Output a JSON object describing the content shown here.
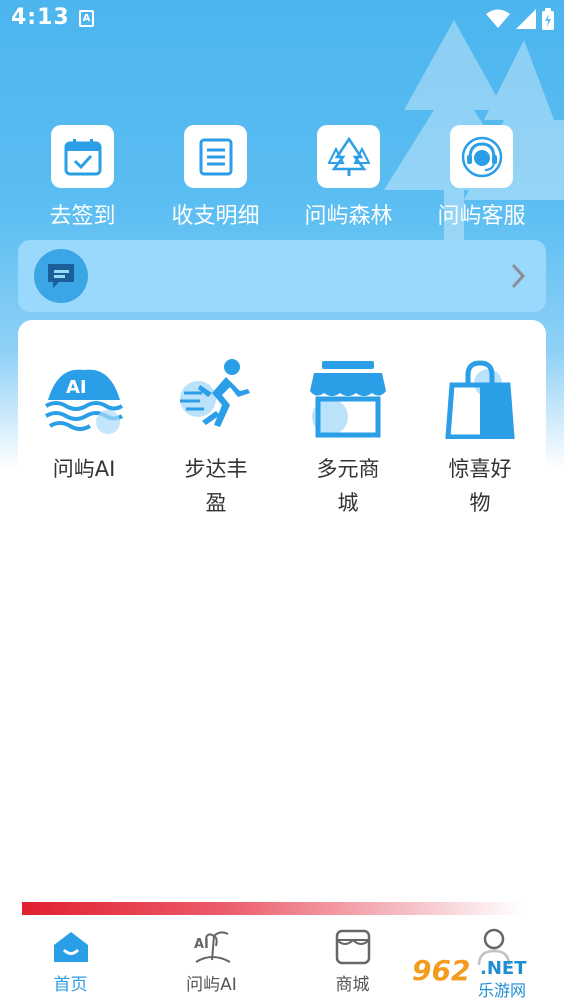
{
  "status_bar": {
    "time": "4:13",
    "app_indicator": "A"
  },
  "quick_actions": [
    {
      "label": "去签到",
      "icon": "calendar-check-icon"
    },
    {
      "label": "收支明细",
      "icon": "document-list-icon"
    },
    {
      "label": "问屿森林",
      "icon": "forest-icon"
    },
    {
      "label": "问屿客服",
      "icon": "customer-service-icon"
    }
  ],
  "notice": {
    "icon": "message-icon",
    "text": ""
  },
  "services": [
    {
      "label": "问屿AI",
      "icon": "ai-island-icon"
    },
    {
      "label": "步达丰盈",
      "icon": "running-man-icon"
    },
    {
      "label": "多元商城",
      "icon": "store-icon"
    },
    {
      "label": "惊喜好物",
      "icon": "shopping-bag-icon"
    }
  ],
  "nav": [
    {
      "label": "首页",
      "icon": "home-icon",
      "active": true
    },
    {
      "label": "问屿AI",
      "icon": "ai-palm-icon",
      "active": false
    },
    {
      "label": "商城",
      "icon": "shop-icon",
      "active": false
    },
    {
      "label": "",
      "icon": "profile-icon",
      "active": false
    }
  ],
  "watermark": {
    "number": "962",
    "suffix": ".NET",
    "text": "乐游网"
  },
  "colors": {
    "primary": "#2a9ee6",
    "sky": "#4cb5ee",
    "notice_bg": "#9ad9fb",
    "accent_red": "#e0202f"
  }
}
